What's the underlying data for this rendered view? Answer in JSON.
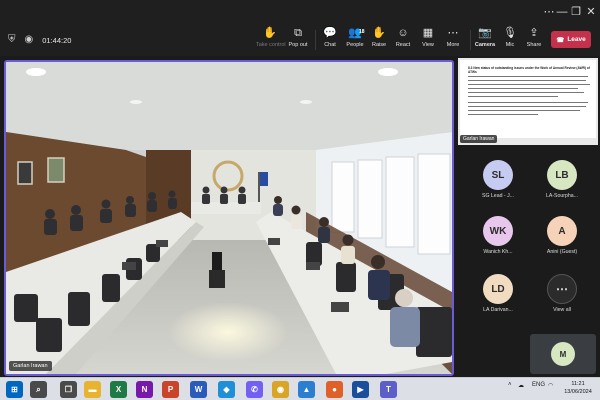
{
  "meeting": {
    "timer": "01:44:20",
    "toolbar": [
      {
        "id": "take-control",
        "label": "Take control",
        "glyph": "✋",
        "enabled": false
      },
      {
        "id": "pop-out",
        "label": "Pop out",
        "glyph": "⧉",
        "enabled": true
      },
      {
        "id": "chat",
        "label": "Chat",
        "glyph": "💬",
        "enabled": true
      },
      {
        "id": "people",
        "label": "People",
        "glyph": "👥",
        "enabled": true,
        "badge": "18"
      },
      {
        "id": "raise",
        "label": "Raise",
        "glyph": "✋",
        "enabled": true
      },
      {
        "id": "react",
        "label": "React",
        "glyph": "☺",
        "enabled": true
      },
      {
        "id": "view",
        "label": "View",
        "glyph": "▦",
        "enabled": true
      },
      {
        "id": "more",
        "label": "More",
        "glyph": "⋯",
        "enabled": true
      },
      {
        "id": "camera",
        "label": "Camera",
        "glyph": "📷",
        "enabled": true
      },
      {
        "id": "mic",
        "label": "Mic",
        "glyph": "🎙",
        "enabled": true
      },
      {
        "id": "share",
        "label": "Share",
        "glyph": "⇪",
        "enabled": true
      }
    ],
    "leave_label": "Leave",
    "main_speaker": "Garlan Irawan",
    "shared_content": {
      "presenter": "Garlan Irawan",
      "heading": "8.3 New status of outstanding issues under the Work of Annual Review (AWR) of ATWs"
    },
    "participants": [
      {
        "initials": "SL",
        "name": "SG Lead - J...",
        "color": "#c6cbf2"
      },
      {
        "initials": "LB",
        "name": "LA-Sourpha...",
        "color": "#d6e7c2"
      },
      {
        "initials": "WK",
        "name": "Wanich Kh...",
        "color": "#e7c8ec"
      },
      {
        "initials": "A",
        "name": "Anini (Guest)",
        "color": "#f6d2b8"
      },
      {
        "initials": "LD",
        "name": "LA Darivan...",
        "color": "#f1dcc2"
      }
    ],
    "view_all_label": "View all",
    "self_view_initials": "M",
    "self_color": "#d6e7c2"
  },
  "taskbar": {
    "apps": [
      {
        "name": "windows-start-icon",
        "glyph": "⊞",
        "color": "#0067c0"
      },
      {
        "name": "search-icon",
        "glyph": "⌕",
        "color": "#4a4a4a"
      },
      {
        "name": "task-view-icon",
        "glyph": "❐",
        "color": "#4a4a4a"
      },
      {
        "name": "file-explorer-icon",
        "glyph": "▬",
        "color": "#e8b42f"
      },
      {
        "name": "excel-icon",
        "glyph": "X",
        "color": "#1f7a45"
      },
      {
        "name": "onenote-icon",
        "glyph": "N",
        "color": "#7719aa"
      },
      {
        "name": "powerpoint-icon",
        "glyph": "P",
        "color": "#c9442a"
      },
      {
        "name": "word-icon",
        "glyph": "W",
        "color": "#2b5bb8"
      },
      {
        "name": "app-blue-icon",
        "glyph": "◆",
        "color": "#1f8fd8"
      },
      {
        "name": "viber-icon",
        "glyph": "✆",
        "color": "#7360f2"
      },
      {
        "name": "chrome-icon",
        "glyph": "◉",
        "color": "#d9a526"
      },
      {
        "name": "photos-icon",
        "glyph": "▲",
        "color": "#2c7fd0"
      },
      {
        "name": "firefox-icon",
        "glyph": "●",
        "color": "#e0602a"
      },
      {
        "name": "media-icon",
        "glyph": "▶",
        "color": "#1a4f9c"
      },
      {
        "name": "teams-icon",
        "glyph": "T",
        "color": "#5b5fc7"
      }
    ],
    "language": "ENG",
    "time": "11:21",
    "date": "13/06/2024"
  }
}
